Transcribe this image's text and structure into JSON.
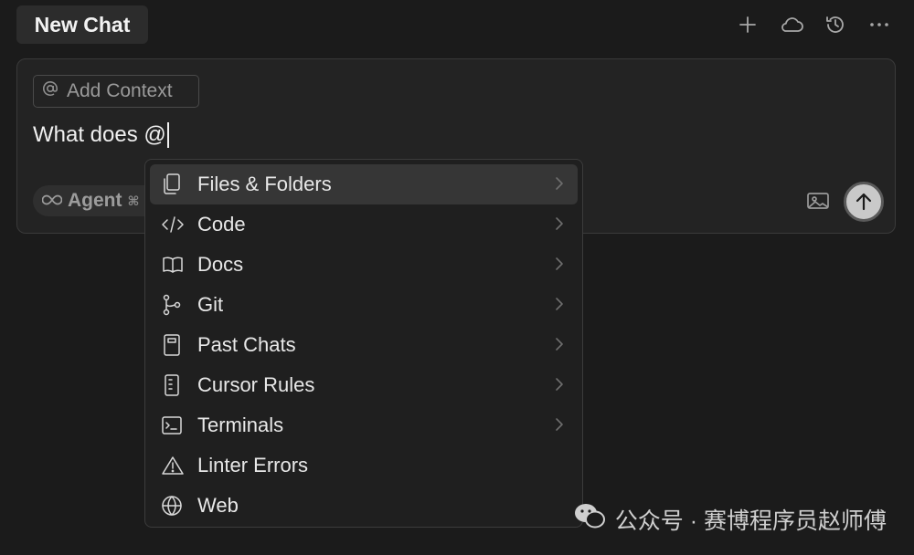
{
  "header": {
    "tab_title": "New Chat",
    "actions": [
      {
        "name": "new-chat",
        "icon": "plus-icon"
      },
      {
        "name": "cloud",
        "icon": "cloud-icon"
      },
      {
        "name": "history",
        "icon": "history-icon"
      },
      {
        "name": "more",
        "icon": "more-icon"
      }
    ]
  },
  "composer": {
    "add_context_label": "Add Context",
    "prompt_text": "What does @",
    "mode_label": "Agent",
    "mode_shortcut": "⌘"
  },
  "mention_menu": {
    "items": [
      {
        "label": "Files & Folders",
        "icon": "files-icon",
        "has_submenu": true,
        "active": true
      },
      {
        "label": "Code",
        "icon": "code-icon",
        "has_submenu": true
      },
      {
        "label": "Docs",
        "icon": "book-icon",
        "has_submenu": true
      },
      {
        "label": "Git",
        "icon": "git-branch-icon",
        "has_submenu": true
      },
      {
        "label": "Past Chats",
        "icon": "notebook-icon",
        "has_submenu": true
      },
      {
        "label": "Cursor Rules",
        "icon": "rules-icon",
        "has_submenu": true
      },
      {
        "label": "Terminals",
        "icon": "terminal-icon",
        "has_submenu": true
      },
      {
        "label": "Linter Errors",
        "icon": "warning-icon",
        "has_submenu": false
      },
      {
        "label": "Web",
        "icon": "globe-icon",
        "has_submenu": false
      }
    ]
  },
  "watermark": {
    "text": "公众号 · 赛博程序员赵师傅",
    "icon": "wechat-icon"
  },
  "colors": {
    "background": "#1b1b1b",
    "panel": "#232323",
    "menu_active": "#363636",
    "send_button": "#c9c9c9"
  }
}
